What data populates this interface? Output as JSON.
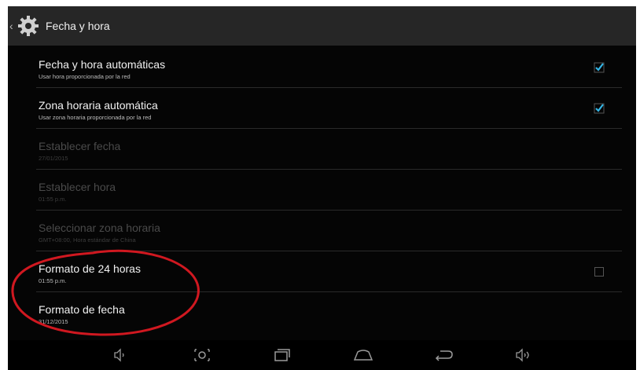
{
  "action_bar": {
    "title": "Fecha y hora",
    "icon": "gear-icon"
  },
  "settings": [
    {
      "title": "Fecha y hora automáticas",
      "summary": "Usar hora proporcionada por la red",
      "enabled": true,
      "checkbox": "checked"
    },
    {
      "title": "Zona horaria automática",
      "summary": "Usar zona horaria proporcionada por la red",
      "enabled": true,
      "checkbox": "checked"
    },
    {
      "title": "Establecer fecha",
      "summary": "27/01/2015",
      "enabled": false
    },
    {
      "title": "Establecer hora",
      "summary": "01:55 p.m.",
      "enabled": false
    },
    {
      "title": "Seleccionar zona horaria",
      "summary": "GMT+08:00, Hora estándar de China",
      "enabled": false
    },
    {
      "title": "Formato de 24 horas",
      "summary": "01:55 p.m.",
      "enabled": true,
      "checkbox": "unchecked"
    },
    {
      "title": "Formato de fecha",
      "summary": "31/12/2015",
      "enabled": true
    }
  ],
  "nav_bar": {
    "buttons": [
      "volume-down-icon",
      "screenshot-icon",
      "recent-apps-icon",
      "home-icon",
      "back-icon",
      "volume-up-icon"
    ]
  },
  "colors": {
    "background": "#050505",
    "action_bar": "#262626",
    "accent_check": "#33b5e5",
    "annotation_circle": "#d01820"
  }
}
